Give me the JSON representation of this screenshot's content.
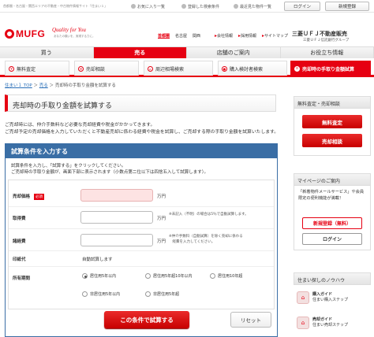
{
  "top": {
    "breadcrumb": "首都圏・名古屋・関西エリアの不動産・中古物件情報サイト「住まい１」",
    "links": [
      {
        "label": "お気に入り一覧",
        "icon": "star-icon"
      },
      {
        "label": "登録した検索条件",
        "icon": "search-icon"
      },
      {
        "label": "最近見た物件一覧",
        "icon": "history-icon"
      }
    ],
    "login": "ログイン",
    "register": "新規登録"
  },
  "header": {
    "logo": "MUFG",
    "tagline": "Quality for You",
    "tagline_sub": "あなたの願いを、実現する力に。",
    "areas": [
      "首都圏",
      "名古屋",
      "関西"
    ],
    "links": [
      "会社情報",
      "採用情報",
      "サイトマップ"
    ],
    "brand_main": "三菱ＵＦＪ不動産販売",
    "brand_sub": "三菱ＵＦＪ信託銀行グループ"
  },
  "tabs": [
    {
      "label": "買う",
      "active": false
    },
    {
      "label": "売る",
      "active": true
    },
    {
      "label": "店舗のご案内",
      "active": false
    },
    {
      "label": "お役立ち情報",
      "active": false
    }
  ],
  "subnav": [
    {
      "label": "無料査定",
      "icon": "yen-icon"
    },
    {
      "label": "売却相談",
      "icon": "chat-icon"
    },
    {
      "label": "周辺相場検索",
      "icon": "map-icon"
    },
    {
      "label": "購入検討者検索",
      "icon": "person-icon"
    },
    {
      "label": "売却時の手取り金額試算",
      "icon": "calculator-icon"
    }
  ],
  "breadcrumb": {
    "home": "住まい１ TOP",
    "sep": "＞",
    "parent": "売る",
    "current": "売却時の手取り金額を試算する"
  },
  "page_title": "売却時の手取り金額を試算する",
  "intro": [
    "ご売却時には、仲介手数料など必要な売却経費や税金がかかってきます。",
    "ご売却予定の売却価格を入力していただくと不動産売却に係わる経費や税金を試算し、ご売却する際の手取り金額を試算いたします。"
  ],
  "form": {
    "heading": "試算条件を入力する",
    "info": [
      "試算条件を入力し、「試算する」をクリックしてください。",
      "ご売却時の手取り金額が、画面下部に表示されます（小数点第二位以下は四捨五入して試算します）。"
    ],
    "fields": {
      "price": {
        "label": "売却価格",
        "required": "必須",
        "value": "",
        "unit": "万円"
      },
      "cost": {
        "label": "取得費",
        "value": "",
        "unit": "万円",
        "note": [
          "※未記入（不明）の場合は5％で自動試算します。"
        ]
      },
      "expense": {
        "label": "諸経費",
        "value": "",
        "unit": "万円",
        "note": [
          "※仲介手数料（自動試算）を除く売却に係わる",
          "　経費を入力してください。"
        ]
      },
      "stamp": {
        "label": "印紙代",
        "value": "自動試算します"
      },
      "period": {
        "label": "所有期間",
        "options": [
          {
            "label": "居住用5年以内",
            "selected": true
          },
          {
            "label": "居住用5年超10年以内",
            "selected": false
          },
          {
            "label": "居住用10年超",
            "selected": false
          },
          {
            "label": "非居住用5年以内",
            "selected": false
          },
          {
            "label": "非居住用5年超",
            "selected": false
          }
        ]
      }
    },
    "submit": "この条件で試算する",
    "reset": "リセット"
  },
  "sidebar": {
    "sale_head": "無料査定・売却相談",
    "sale_buttons": [
      "無料査定",
      "売却相談"
    ],
    "mypage_head": "マイページのご案内",
    "mypage_text": "「新着物件メールサービス」や会員限定の便利機能が満載！",
    "mypage_button": "新規登録（無料）",
    "login_button": "ログイン",
    "knowhow_head": "住まい探しのノウハウ",
    "guides": [
      {
        "title": "購入ガイド",
        "sub": "住まい購入ステップ"
      },
      {
        "title": "売却ガイド",
        "sub": "住まい売却ステップ"
      }
    ]
  },
  "colors": {
    "brand_red": "#e60012",
    "form_blue": "#3a6ea5"
  }
}
